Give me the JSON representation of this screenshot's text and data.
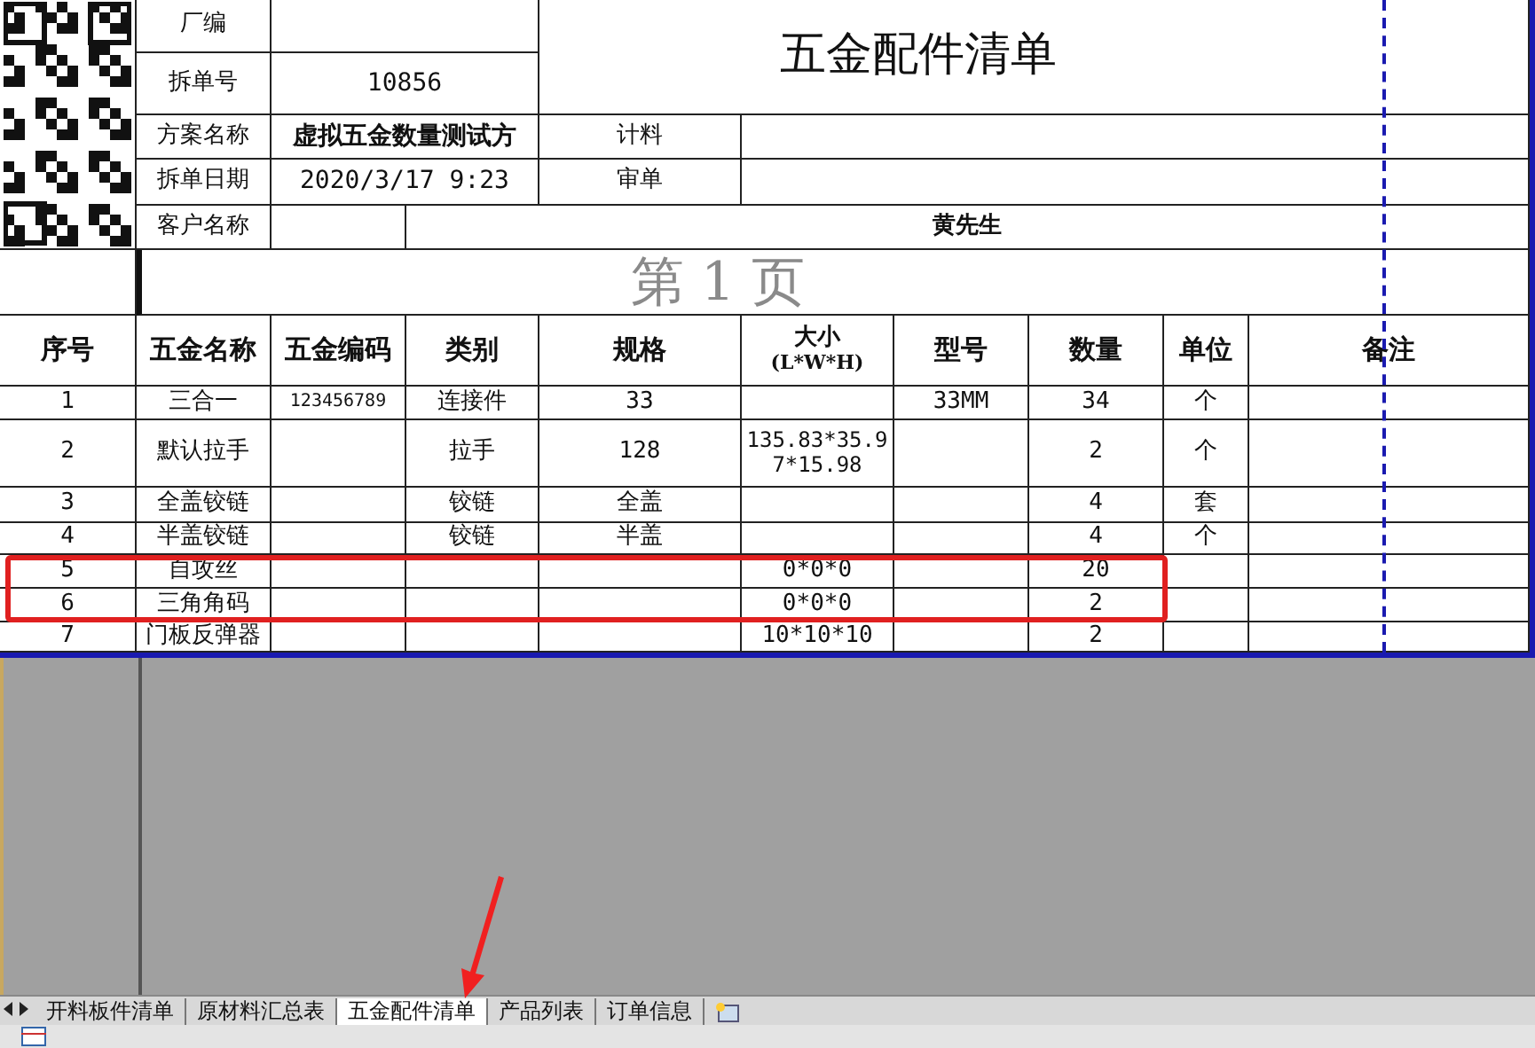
{
  "sheet": {
    "title": "五金配件清单",
    "page_label": "第 1 页",
    "fields": [
      {
        "kind": "normal",
        "label": "厂编"
      },
      {
        "kind": "normal",
        "label": "拆单号",
        "value": "10856"
      },
      {
        "kind": "normal",
        "label": "方案名称",
        "value": "虚拟五金数量测试方"
      },
      {
        "kind": "normal",
        "label": "拆单日期",
        "value": "2020/3/17  9:23"
      },
      {
        "kind": "split",
        "label": "客户名称",
        "value": "黄先生"
      }
    ],
    "side_fields": [
      {
        "label": "计料"
      },
      {
        "label": "审单"
      }
    ],
    "columns": [
      {
        "label": "序号"
      },
      {
        "label": "五金名称"
      },
      {
        "label": "五金编码"
      },
      {
        "label": "类别"
      },
      {
        "label": "规格"
      },
      {
        "label": "大小",
        "sublabel": "(L*W*H)"
      },
      {
        "label": "型号"
      },
      {
        "label": "数量"
      },
      {
        "label": "单位"
      },
      {
        "label": "备注"
      }
    ],
    "rows": [
      {
        "no": "1",
        "name": "三合一",
        "code": "123456789",
        "category": "连接件",
        "spec": "33",
        "model": "33MM",
        "qty": "34",
        "unit": "个",
        "marked": false
      },
      {
        "no": "2",
        "name": "默认拉手",
        "category": "拉手",
        "spec": "128",
        "size": "135.83*35.97*15.98",
        "qty": "2",
        "unit": "个",
        "marked": false
      },
      {
        "no": "3",
        "name": "全盖铰链",
        "category": "铰链",
        "spec": "全盖",
        "qty": "4",
        "unit": "套",
        "marked": false
      },
      {
        "no": "4",
        "name": "半盖铰链",
        "category": "铰链",
        "spec": "半盖",
        "qty": "4",
        "unit": "个",
        "marked": false
      },
      {
        "no": "5",
        "name": "自攻丝",
        "size": "0*0*0",
        "qty": "20",
        "marked": true
      },
      {
        "no": "6",
        "name": "三角角码",
        "size": "0*0*0",
        "qty": "2",
        "marked": true
      },
      {
        "no": "7",
        "name": "门板反弹器",
        "size": "10*10*10",
        "qty": "2",
        "marked": false
      }
    ]
  },
  "sheet_tabs": [
    {
      "label": "开料板件清单",
      "selected": false
    },
    {
      "label": "原材料汇总表",
      "selected": false
    },
    {
      "label": "五金配件清单",
      "selected": true
    },
    {
      "label": "产品列表",
      "selected": false
    },
    {
      "label": "订单信息",
      "selected": false
    }
  ]
}
